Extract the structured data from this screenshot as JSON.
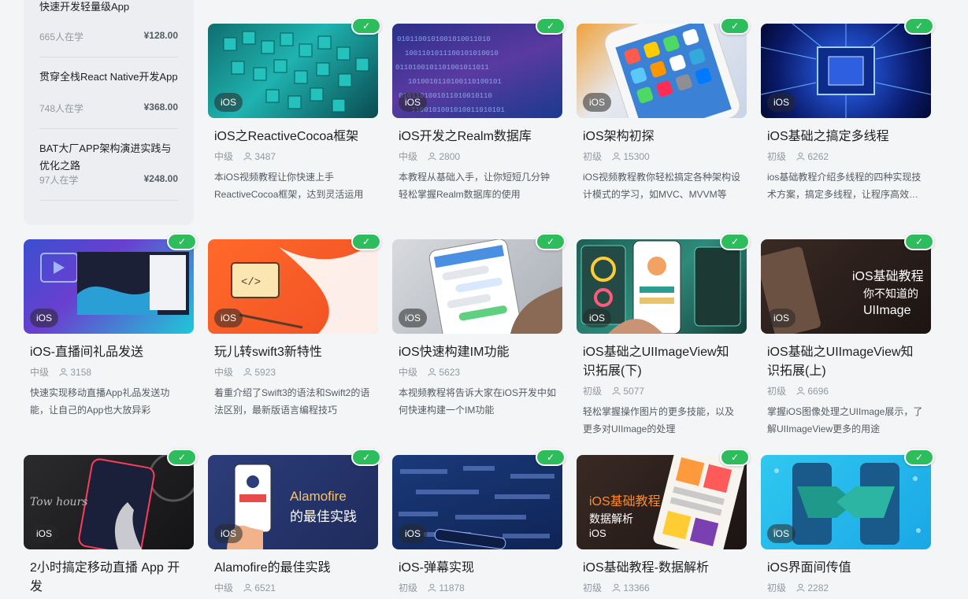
{
  "sidebar": {
    "items": [
      {
        "title": "快速开发轻量级App",
        "students": "665人在学",
        "price": "¥128.00"
      },
      {
        "title": "贯穿全栈React Native开发App",
        "students": "748人在学",
        "price": "¥368.00"
      },
      {
        "title": "BAT大厂APP架构演进实践与优化之路",
        "students": "97人在学",
        "price": "¥248.00"
      }
    ]
  },
  "tag_label": "iOS",
  "check_glyph": "✓",
  "courses": [
    {
      "title": "iOS之ReactiveCocoa框架",
      "level": "中级",
      "count": "3487",
      "desc": "本iOS视频教程让你快速上手ReactiveCocoa框架，达到灵活运用"
    },
    {
      "title": "iOS开发之Realm数据库",
      "level": "中级",
      "count": "2800",
      "desc": "本教程从基础入手，让你短短几分钟轻松掌握Realm数据库的使用"
    },
    {
      "title": "iOS架构初探",
      "level": "初级",
      "count": "15300",
      "desc": "iOS视频教程教你轻松搞定各种架构设计模式的学习，如MVC、MVVM等"
    },
    {
      "title": "iOS基础之搞定多线程",
      "level": "初级",
      "count": "6262",
      "desc": "ios基础教程介绍多线程的四种实现技术方案，搞定多线程，让程序高效…"
    },
    {
      "title": "iOS-直播间礼品发送",
      "level": "中级",
      "count": "3158",
      "desc": "快速实现移动直播App礼品发送功能，让自己的App也大放异彩"
    },
    {
      "title": "玩儿转swift3新特性",
      "level": "中级",
      "count": "5923",
      "desc": "着重介绍了Swift3的语法和Swift2的语法区别，最新版语言编程技巧"
    },
    {
      "title": "iOS快速构建IM功能",
      "level": "中级",
      "count": "5623",
      "desc": "本视频教程将告诉大家在iOS开发中如何快速构建一个IM功能"
    },
    {
      "title": "iOS基础之UIImageView知识拓展(下)",
      "level": "初级",
      "count": "5077",
      "desc": "轻松掌握操作图片的更多技能，以及更多对UIImage的处理"
    },
    {
      "title": "iOS基础之UIImageView知识拓展(上)",
      "level": "初级",
      "count": "6696",
      "desc": "掌握iOS图像处理之UIImage展示，了解UIImageView更多的用途"
    },
    {
      "title": "2小时搞定移动直播 App 开发",
      "level": "",
      "count": "",
      "desc": ""
    },
    {
      "title": "Alamofire的最佳实践",
      "level": "中级",
      "count": "6521",
      "desc": ""
    },
    {
      "title": "iOS-弹幕实现",
      "level": "初级",
      "count": "11878",
      "desc": ""
    },
    {
      "title": "iOS基础教程-数据解析",
      "level": "初级",
      "count": "13366",
      "desc": ""
    },
    {
      "title": "iOS界面间传值",
      "level": "初级",
      "count": "2282",
      "desc": ""
    }
  ],
  "thumb_texts": {
    "c8_title": "iOS基础教程",
    "c8_sub1": "你不知道的",
    "c8_sub2": "UIImage",
    "c10_line1": "Alamofire",
    "c10_line2": "的最佳实践",
    "c9_script": "Tow hours",
    "c12_line1": "iOS基础教程",
    "c12_line2": "数据解析",
    "c12_line3": "iOS"
  },
  "colors": {
    "check": "#2dbd5c",
    "background": "#f4f5f7"
  }
}
